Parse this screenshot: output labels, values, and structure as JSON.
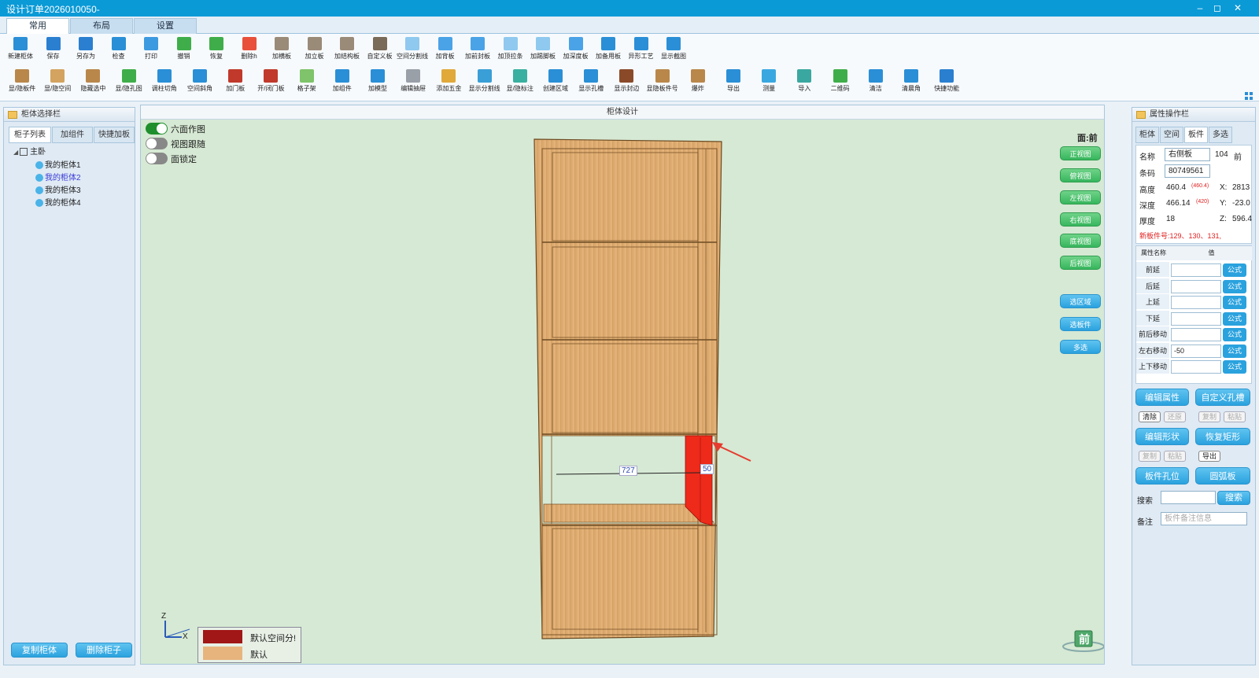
{
  "window": {
    "title": "设计订单2026010050-",
    "controls": [
      "–",
      "◻",
      "✕"
    ]
  },
  "ribbon_tabs": [
    {
      "label": "常用",
      "active": true
    },
    {
      "label": "布局",
      "active": false
    },
    {
      "label": "设置",
      "active": false
    }
  ],
  "toolbar_row1": [
    {
      "label": "新建柜体",
      "icon": "new-cabinet-icon",
      "color": "#2a8fd6"
    },
    {
      "label": "保存",
      "icon": "save-icon",
      "color": "#2a7fd0"
    },
    {
      "label": "另存为",
      "icon": "save-as-icon",
      "color": "#2a7fd0"
    },
    {
      "label": "检查",
      "icon": "check-icon",
      "color": "#2a8fd6"
    },
    {
      "label": "打印",
      "icon": "print-icon",
      "color": "#3d9ae0"
    },
    {
      "label": "撤销",
      "icon": "undo-icon",
      "color": "#3fae4a"
    },
    {
      "label": "恢复",
      "icon": "redo-icon",
      "color": "#3fae4a"
    },
    {
      "label": "删除h",
      "icon": "delete-icon",
      "color": "#e8503a"
    },
    {
      "label": "加横板",
      "icon": "add-horizontal-board-icon",
      "color": "#9a8a78"
    },
    {
      "label": "加立板",
      "icon": "add-vertical-board-icon",
      "color": "#9a8a78"
    },
    {
      "label": "加结构板",
      "icon": "add-structure-board-icon",
      "color": "#9a8a78"
    },
    {
      "label": "自定义板",
      "icon": "custom-board-icon",
      "color": "#7a6a58"
    },
    {
      "label": "空间分割线",
      "icon": "space-divider-icon",
      "color": "#8fc9ef"
    },
    {
      "label": "加背板",
      "icon": "add-back-board-icon",
      "color": "#4aa3e6"
    },
    {
      "label": "加前封板",
      "icon": "add-front-cover-icon",
      "color": "#4aa3e6"
    },
    {
      "label": "加顶拉条",
      "icon": "add-top-strip-icon",
      "color": "#8fc9ef"
    },
    {
      "label": "加踢脚板",
      "icon": "add-kickboard-icon",
      "color": "#8fc9ef"
    },
    {
      "label": "加深度板",
      "icon": "add-depth-board-icon",
      "color": "#4aa3e6"
    },
    {
      "label": "加备用板",
      "icon": "add-spare-board-icon",
      "color": "#2a8fd6"
    },
    {
      "label": "异形工艺",
      "icon": "shaped-process-icon",
      "color": "#2a8fd6"
    },
    {
      "label": "显示截图",
      "icon": "show-screenshot-icon",
      "color": "#2a8fd6"
    }
  ],
  "toolbar_row2": [
    {
      "label": "显/隐板件",
      "icon": "toggle-boards-icon",
      "color": "#b9874a"
    },
    {
      "label": "显/隐空间",
      "icon": "toggle-space-icon",
      "color": "#d4a360"
    },
    {
      "label": "隐藏选中",
      "icon": "hide-selected-icon",
      "color": "#b9874a"
    },
    {
      "label": "显/隐孔图",
      "icon": "toggle-holes-icon",
      "color": "#3fae4a"
    },
    {
      "label": "调柱切角",
      "icon": "pillar-cut-icon",
      "color": "#2a8fd6"
    },
    {
      "label": "空间斜角",
      "icon": "space-bevel-icon",
      "color": "#2a8fd6"
    },
    {
      "label": "加门板",
      "icon": "add-door-icon",
      "color": "#c0392b"
    },
    {
      "label": "开/闭门板",
      "icon": "open-close-door-icon",
      "color": "#c0392b"
    },
    {
      "label": "格子架",
      "icon": "grid-rack-icon",
      "color": "#7fc36a"
    },
    {
      "label": "加组件",
      "icon": "add-component-icon",
      "color": "#2a8fd6"
    },
    {
      "label": "加模型",
      "icon": "add-model-icon",
      "color": "#2a8fd6"
    },
    {
      "label": "编辑抽屉",
      "icon": "edit-drawer-icon",
      "color": "#9aa0a8"
    },
    {
      "label": "添加五金",
      "icon": "add-hardware-icon",
      "color": "#e0a93a"
    },
    {
      "label": "显示分割线",
      "icon": "show-divider-icon",
      "color": "#3a9fd6"
    },
    {
      "label": "显/隐标注",
      "icon": "toggle-annotation-icon",
      "color": "#3ab0a0"
    },
    {
      "label": "创建区域",
      "icon": "create-region-icon",
      "color": "#2a8fd6"
    },
    {
      "label": "显示孔槽",
      "icon": "show-slots-icon",
      "color": "#2a8fd6"
    },
    {
      "label": "显示封边",
      "icon": "show-edge-icon",
      "color": "#8a4a2a"
    },
    {
      "label": "显隐板件号",
      "icon": "toggle-board-number-icon",
      "color": "#b9874a"
    },
    {
      "label": "爆炸",
      "icon": "explode-icon",
      "color": "#b9874a"
    },
    {
      "label": "导出",
      "icon": "export-icon",
      "color": "#2a8fd6"
    },
    {
      "label": "测量",
      "icon": "measure-icon",
      "color": "#3aa8e0"
    },
    {
      "label": "导入",
      "icon": "import-icon",
      "color": "#3aa8a0"
    },
    {
      "label": "二维码",
      "icon": "qrcode-icon",
      "color": "#3fae4a"
    },
    {
      "label": "清洁",
      "icon": "clean-icon",
      "color": "#2a8fd6"
    },
    {
      "label": "清晨角",
      "icon": "corner-icon",
      "color": "#2a8fd6"
    },
    {
      "label": "快捷功能",
      "icon": "quick-function-icon",
      "color": "#2a7fd0"
    }
  ],
  "left_panel": {
    "title": "柜体选择栏",
    "tabs": [
      "柜子列表",
      "加组件",
      "快捷加板"
    ],
    "tree_root": "主卧",
    "cabinets": [
      "我的柜体1",
      "我的柜体2",
      "我的柜体3",
      "我的柜体4"
    ],
    "selected_index": 1,
    "copy_btn": "复制柜体",
    "delete_btn": "删除柜子"
  },
  "viewport": {
    "title": "柜体设计",
    "face_label": "面:前",
    "toggles": [
      {
        "label": "六面作图",
        "on": true
      },
      {
        "label": "视图跟随",
        "on": false
      },
      {
        "label": "面锁定",
        "on": false
      }
    ],
    "view_buttons": [
      "正视图",
      "俯视图",
      "左视图",
      "右视图",
      "底视图",
      "后视图"
    ],
    "action_buttons": [
      "选区域",
      "选板件",
      "多选"
    ],
    "dimension_width": "727",
    "dimension_depth": "50",
    "axis_labels": [
      "Z",
      "X"
    ],
    "legend": [
      {
        "label": "默认空间分!",
        "color": "#a11616"
      },
      {
        "label": "默认",
        "color": "#e7b47d"
      }
    ],
    "view_cube_label": "前"
  },
  "right_panel": {
    "title": "属性操作栏",
    "tabs": [
      "柜体",
      "空间",
      "板件",
      "多选"
    ],
    "active_tab": 2,
    "name_label": "名称",
    "name_value": "右侧板",
    "name_num": "104",
    "name_face": "前",
    "code_label": "条码",
    "code_value": "80749561",
    "height_label": "高度",
    "height_value": "460.4",
    "height_note": "(460.4)",
    "x_label": "X:",
    "x_value": "2813",
    "depth_label": "深度",
    "depth_value": "466.14",
    "depth_note": "(420)",
    "y_label": "Y:",
    "y_value": "-23.0",
    "thick_label": "厚度",
    "thick_value": "18",
    "z_label": "Z:",
    "z_value": "596.4",
    "new_board_note": "新板件号:129、130、131,",
    "grid_header_name": "属性名称",
    "grid_header_val": "值",
    "grid_rows": [
      {
        "name": "前延",
        "value": "",
        "btn": "公式"
      },
      {
        "name": "后延",
        "value": "",
        "btn": "公式"
      },
      {
        "name": "上延",
        "value": "",
        "btn": "公式"
      },
      {
        "name": "下延",
        "value": "",
        "btn": "公式"
      },
      {
        "name": "前后移动",
        "value": "",
        "btn": "公式"
      },
      {
        "name": "左右移动",
        "value": "-50",
        "btn": "公式"
      },
      {
        "name": "上下移动",
        "value": "",
        "btn": "公式"
      }
    ],
    "edit_attr_btn": "编辑属性",
    "custom_hole_btn": "自定义孔槽",
    "clear_btn": "清除",
    "restore_btn": "还原",
    "copy_btn": "复制",
    "paste_btn": "粘贴",
    "edit_shape_btn": "编辑形状",
    "restore_rect_btn": "恢复矩形",
    "copy2_btn": "复制",
    "paste2_btn": "粘贴",
    "export_btn": "导出",
    "board_hole_btn": "板件孔位",
    "arc_board_btn": "圆弧板",
    "search_label": "搜索",
    "search_btn": "搜索",
    "note_label": "备注",
    "note_placeholder": "板件备注信息"
  }
}
